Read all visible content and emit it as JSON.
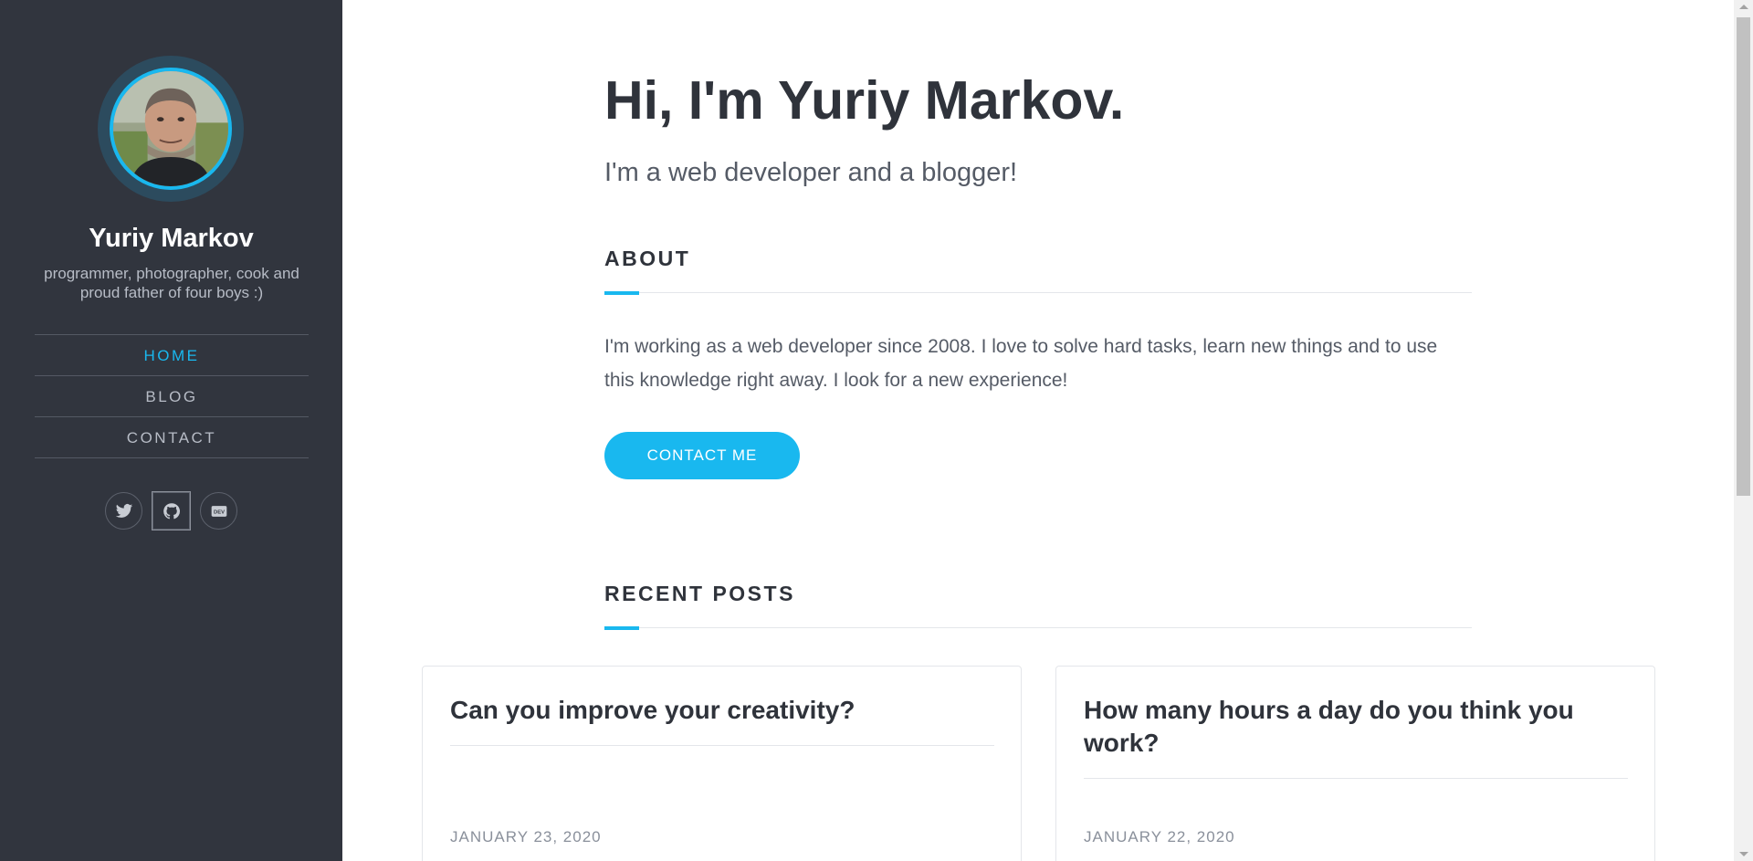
{
  "sidebar": {
    "name": "Yuriy Markov",
    "bio": "programmer, photographer, cook and proud father of four boys :)",
    "nav": [
      {
        "label": "HOME",
        "active": true
      },
      {
        "label": "BLOG",
        "active": false
      },
      {
        "label": "CONTACT",
        "active": false
      }
    ],
    "socials": [
      {
        "icon": "twitter-icon"
      },
      {
        "icon": "github-icon"
      },
      {
        "icon": "dev-icon"
      }
    ]
  },
  "hero": {
    "title": "Hi, I'm Yuriy Markov.",
    "subtitle": "I'm a web developer and a blogger!"
  },
  "about": {
    "heading": "ABOUT",
    "text": "I'm working as a web developer since 2008. I love to solve hard tasks, learn new things and to use this knowledge right away. I look for a new experience!",
    "button_label": "CONTACT ME"
  },
  "recent_posts": {
    "heading": "RECENT POSTS",
    "posts": [
      {
        "title": "Can you improve your creativity?",
        "date": "JANUARY 23, 2020"
      },
      {
        "title": "How many hours a day do you think you work?",
        "date": "JANUARY 22, 2020"
      }
    ]
  },
  "colors": {
    "accent": "#19b8ef",
    "sidebar_bg": "#31353e",
    "text_dark": "#2f333b"
  }
}
